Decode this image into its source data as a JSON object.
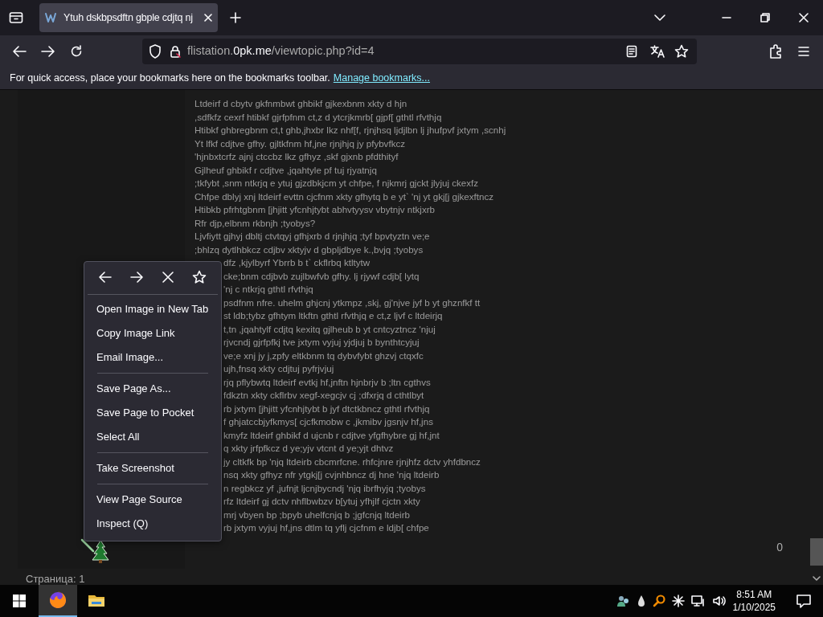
{
  "browser": {
    "tab": {
      "title": "Ytuh dskbpsdftn gbple cdjtq nj",
      "selected": true
    },
    "url": {
      "host_prefix": "flistation.",
      "domain": "0pk.me",
      "path": "/viewtopic.php?id=4"
    },
    "bookmarks_bar": {
      "message": "For quick access, place your bookmarks here on the bookmarks toolbar.",
      "link": "Manage bookmarks..."
    }
  },
  "post": {
    "lines": [
      "Ltdeirf d cbytv gkfnmbwt ghbikf gjkexbnm xkty d hjn",
      ",sdfkfz cexrf htibkf gjrfpfnm ct,z d ytcrjkmrb[ gjpf[ gthtl rfvthjq",
      "Htibkf ghbregbnm ct,t ghb,jhxbr lkz nhf[f, rjnjhsq ljdjlbn lj jhufpvf jxtym ,scnhj",
      "Yt lfkf cdjtve gfhy. gjltkfnm hf,jne rjnjhjq jy pfybvfkcz",
      "'hjnbxtcrfz ajnj ctccbz lkz gfhyz ,skf gjxnb pfdthityf",
      "Gjlheuf ghbikf r cdjtve ,jqahtyle pf tuj rjyatnjq",
      ";tkfybt ,snm ntkrjq e ytuj gjzdbkjcm yt chfpe, f njkmrj gjckt jlyjuj ckexfz",
      "Chfpe dblyj xnj ltdeirf evttn cjcfnm xkty gfhytq b e yt` 'nj yt gkj[j gjkexftncz",
      "Htibkb pfrhtgbnm [jhjitt yfcnhjtybt abhvtyysv vbytnjv ntkjxrb",
      "Rfr djp,elbnm rkbnjh ;tyobys?",
      "Ljvfiytt gjhyj dbltj ctvtqyj gfhjxrb d rjnjhjq ;tyf bpvtyztn ve;e",
      ";bhlzq dytlhbkcz cdjbv xktyjv d gbpljdbye k.,bvjq ;tyobys"
    ],
    "lines_beside_menu": [
      "dfz ,kjylbyrf Ybrrb b t` ckflrbq ktltytw",
      "cke;bnm cdjbvb zujlbwfvb gfhy. lj rjywf cdjb[ lytq",
      "'nj c ntkrjq gthtl rfvthjq",
      "psdfnm nfre. uhelm ghjcnj ytkmpz ,skj, gj'njve jyf b yt ghznfkf tt",
      "st ldb;tybz gfhtym ltkftn gthtl rfvthjq e ct,z ljvf c ltdeirjq",
      "t,tn ,jqahtylf cdjtq kexitq gjlheub b yt cntcyztncz 'njuj",
      "rjvcndj gjrfpfkj tve jxtym vyjuj yjdjuj b bynthtcyjuj",
      "ve;e xnj jy j,zpfy eltkbnm tq dybvfybt ghzvj ctqxfc",
      "ujh,fnsq xkty cdjtuj pyfrjvjuj",
      "rjq pflybwtq ltdeirf evtkj hf,jnftn hjnbrjv b ;ltn cgthvs",
      "fdkztn xkty ckflrbv xegf-xegcjv cj ;dfxrjq d cthtlbyt",
      "rb jxtym [jhjitt yfcnhjtybt b jyf dtctkbncz gthtl rfvthjq",
      "f ghjatccbjyfkmys[ cjcfkmobw c ,jkmibv jgsnjv hf,jns",
      "kmyfz ltdeirf ghbikf d ujcnb r cdjtve yfgfhybre gj hf,jnt",
      "q xkty jrfpfkcz d ye;yjv vtcnt d ye;yjt dhtvz",
      "jy cltkfk bp 'njq ltdeirb cbcmrfcne. rhfcjnre rjnjhfz dctv yhfdbncz",
      "nsq xkty gfhyz nfr ytgkj[j cvjnhbncz dj hne 'njq ltdeirb",
      "n regbkcz yf ,jufnjt ljcnjbycndj 'njq ibrfhyjq ;tyobys",
      "rfz ltdeirf gj dctv nhflbwbzv b[ytuj yfhjlf cjctn xkty",
      "mrj vbyen bp ;bpyb uhelfcnjq b ;jgfcnjq ltdeirb",
      "rb jxtym vyjuj hf,jns dtlm tq yflj cjcfnm e ldjb[ chfpe"
    ],
    "counter": "0"
  },
  "pagination": "Страница: 1",
  "context_menu": {
    "items": [
      {
        "kind": "item",
        "label": "Open Image in New Tab"
      },
      {
        "kind": "item",
        "label": "Copy Image Link"
      },
      {
        "kind": "item",
        "label": "Email Image..."
      },
      {
        "kind": "separator"
      },
      {
        "kind": "item",
        "label": "Save Page As..."
      },
      {
        "kind": "item",
        "label": "Save Page to Pocket"
      },
      {
        "kind": "item",
        "label": "Select All"
      },
      {
        "kind": "separator"
      },
      {
        "kind": "item",
        "label": "Take Screenshot"
      },
      {
        "kind": "separator"
      },
      {
        "kind": "item",
        "label": "View Page Source"
      },
      {
        "kind": "item",
        "label": "Inspect (Q)"
      }
    ]
  },
  "taskbar": {
    "apps": [
      {
        "kind": "firefox",
        "selected": true
      },
      {
        "kind": "explorer",
        "selected": false
      }
    ],
    "time": "8:51 AM",
    "date": "1/10/2025"
  }
}
